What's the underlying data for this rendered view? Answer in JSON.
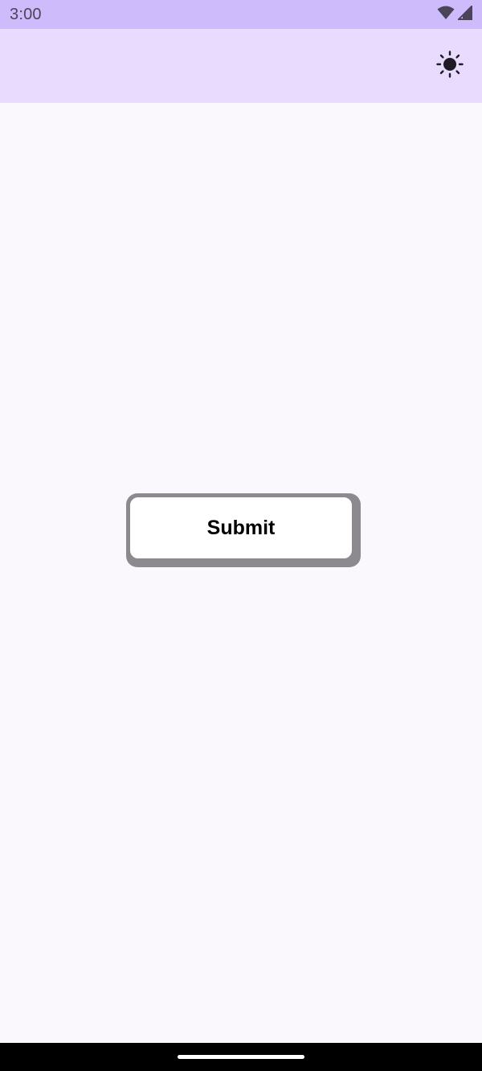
{
  "status_bar": {
    "time": "3:00",
    "icons": [
      "wifi-icon",
      "signal-icon"
    ]
  },
  "top_bar": {
    "action_icon": "sun-icon"
  },
  "main": {
    "submit_label": "Submit"
  },
  "colors": {
    "status_bar_bg": "#cdbbfb",
    "top_bar_bg": "#e8dbfd",
    "background": "#fbf8fd",
    "button_shadow": "#8c8a8f"
  }
}
